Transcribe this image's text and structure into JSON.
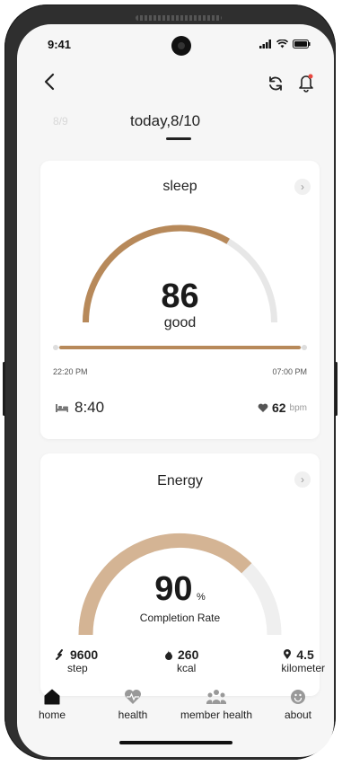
{
  "status_bar": {
    "time": "9:41"
  },
  "date_tabs": {
    "previous": "8/9",
    "current": "today,8/10"
  },
  "sleep": {
    "title": "sleep",
    "score": "86",
    "rating": "good",
    "score_fraction": 0.86,
    "start_time": "22:20 PM",
    "end_time": "07:00 PM",
    "duration": "8:40",
    "heart_rate": "62",
    "heart_rate_unit": "bpm"
  },
  "energy": {
    "title": "Energy",
    "score": "90",
    "unit": "%",
    "label": "Completion Rate",
    "score_fraction": 0.75,
    "steps": "9600",
    "steps_unit": "step",
    "kcal": "260",
    "kcal_unit": "kcal",
    "distance": "4.5",
    "distance_unit": "kilometer"
  },
  "tabs": [
    {
      "label": "home"
    },
    {
      "label": "health"
    },
    {
      "label": "member health"
    },
    {
      "label": "about"
    }
  ],
  "colors": {
    "accent": "#b7895a",
    "track": "#e7e7e7",
    "background": "#f6f6f6"
  },
  "icons": [
    "back-arrow-icon",
    "refresh-icon",
    "bell-icon",
    "chevron-right-icon",
    "bed-icon",
    "heart-icon",
    "walk-icon",
    "flame-icon",
    "location-pin-icon",
    "home-icon",
    "heart-pulse-icon",
    "people-icon",
    "smile-icon"
  ]
}
